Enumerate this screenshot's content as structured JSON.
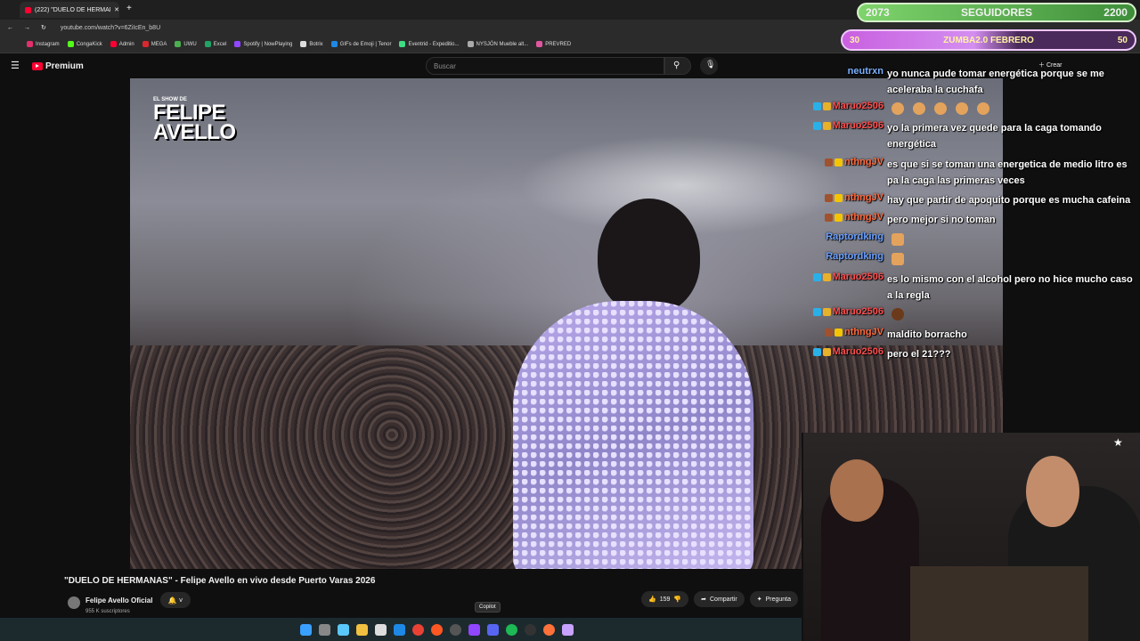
{
  "browser": {
    "tab_title": "(222) \"DUELO DE HERMANA",
    "url": "youtube.com/watch?v=6ZiIcEn_b8U",
    "bookmarks": [
      "Instagram",
      "CongaKick",
      "Admin",
      "MEGA",
      "UWU",
      "Excel",
      "Spotify | NowPlaying",
      "Botrix",
      "GIFs de Emoji | Tenor",
      "Eventrid - Expeditio...",
      "NYSJÓN Mueble alt...",
      "PREVRED"
    ]
  },
  "youtube": {
    "logo": "Premium",
    "search_placeholder": "Buscar",
    "create_label": "Crear",
    "video_title": "\"DUELO DE HERMANAS\" - Felipe Avello en vivo desde Puerto Varas 2026",
    "channel_name": "Felipe Avello Oficial",
    "subscribers": "955 K suscriptores",
    "likes": "159",
    "share_label": "Compartir",
    "ask_label": "Pregunta",
    "watermark_small": "EL SHOW DE",
    "watermark_line1": "FELIPE",
    "watermark_line2": "AVELLO"
  },
  "goals": {
    "followers_current": "2073",
    "followers_label": "SEGUIDORES",
    "followers_target": "2200",
    "zumba_current": "30",
    "zumba_label": "ZUMBA2.0 FEBRERO",
    "zumba_target": "50"
  },
  "chat": [
    {
      "user": "neutrxn",
      "color": "#7ab0ff",
      "lines": [
        "yo nunca pude tomar energética porque se me",
        "aceleraba la cuchafa"
      ]
    },
    {
      "user": "Maruo2506",
      "color": "#ff4d4d",
      "lines": [
        "emotes"
      ]
    },
    {
      "user": "Maruo2506",
      "color": "#ff4d4d",
      "lines": [
        "yo la primera vez quede para la caga tomando",
        "energética"
      ]
    },
    {
      "user": "nthngJV",
      "color": "#ff6a3d",
      "lines": [
        "es que si se toman una energetica de medio litro es",
        "pa la caga las primeras veces"
      ]
    },
    {
      "user": "nthngJV",
      "color": "#ff6a3d",
      "lines": [
        "hay que partir de apoquito porque es mucha cafeina"
      ]
    },
    {
      "user": "nthngJV",
      "color": "#ff6a3d",
      "lines": [
        "pero mejor si no toman"
      ]
    },
    {
      "user": "Raptordking",
      "color": "#6aa0ff",
      "lines": [
        "emote"
      ]
    },
    {
      "user": "Raptordking",
      "color": "#6aa0ff",
      "lines": [
        "emote"
      ]
    },
    {
      "user": "Maruo2506",
      "color": "#ff4d4d",
      "lines": [
        "es lo mismo con el alcohol pero no hice mucho caso",
        "a la regla"
      ]
    },
    {
      "user": "Maruo2506",
      "color": "#ff4d4d",
      "lines": [
        "emote"
      ]
    },
    {
      "user": "nthngJV",
      "color": "#ff6a3d",
      "lines": [
        "maldito borracho"
      ]
    },
    {
      "user": "Maruo2506",
      "color": "#ff4d4d",
      "lines": [
        "pero el 21???"
      ]
    }
  ],
  "taskbar": {
    "tooltip": "Copilot"
  }
}
